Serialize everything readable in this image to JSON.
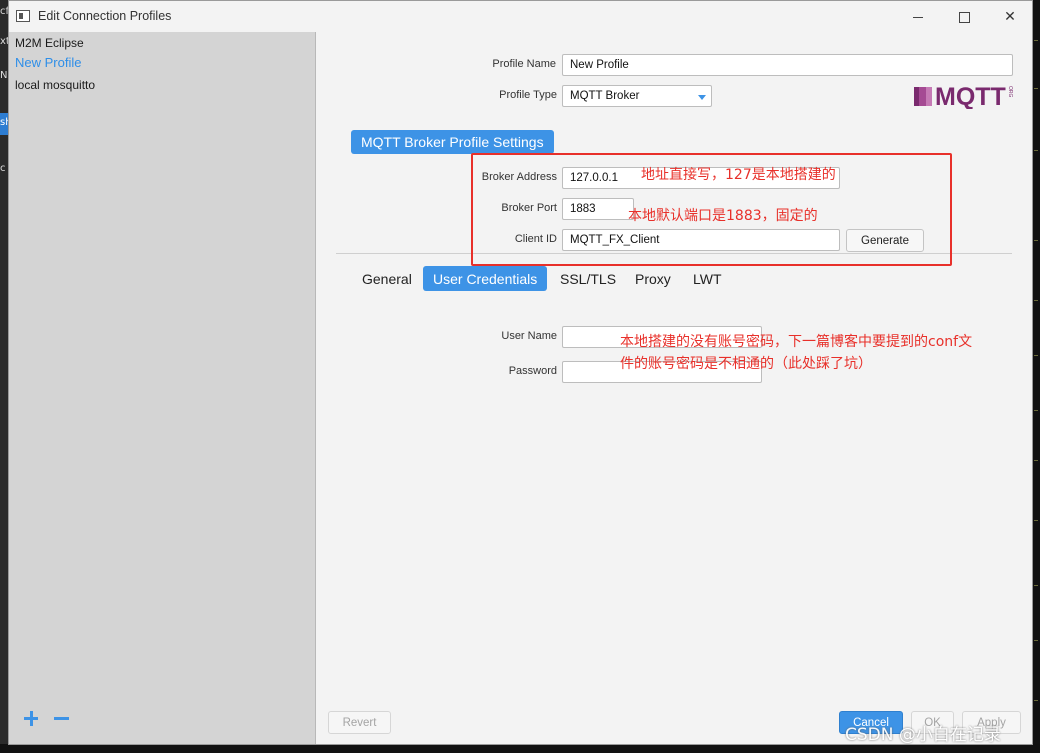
{
  "window": {
    "title": "Edit Connection Profiles",
    "close_glyph": "✕"
  },
  "sidebar": {
    "profiles": [
      {
        "label": "M2M Eclipse"
      },
      {
        "label": "New Profile"
      },
      {
        "label": "local mosquitto"
      }
    ],
    "selected_profile": "New Profile"
  },
  "profile": {
    "name_label": "Profile Name",
    "name_value": "New Profile",
    "type_label": "Profile Type",
    "type_value": "MQTT Broker"
  },
  "logo": {
    "text": "MQTT",
    "subtext": "ORG"
  },
  "broker": {
    "section_title": "MQTT Broker Profile Settings",
    "address_label": "Broker Address",
    "address_value": "127.0.0.1",
    "port_label": "Broker Port",
    "port_value": "1883",
    "client_id_label": "Client ID",
    "client_id_value": "MQTT_FX_Client",
    "generate_label": "Generate"
  },
  "tabs": [
    {
      "label": "General"
    },
    {
      "label": "User Credentials"
    },
    {
      "label": "SSL/TLS"
    },
    {
      "label": "Proxy"
    },
    {
      "label": "LWT"
    }
  ],
  "credentials": {
    "username_label": "User Name",
    "username_value": "",
    "password_label": "Password",
    "password_value": ""
  },
  "footer": {
    "revert_label": "Revert",
    "cancel_label": "Cancel",
    "ok_label": "OK",
    "apply_label": "Apply"
  },
  "annotations": {
    "address_note": "地址直接写，127是本地搭建的",
    "port_note": "本地默认端口是1883，固定的",
    "credentials_note_line1": "本地搭建的没有账号密码，下一篇博客中要提到的conf文",
    "credentials_note_line2": "件的账号密码是不相通的（此处踩了坑）"
  },
  "watermark": "CSDN @小白在记录",
  "background_fragments": [
    "cfi",
    "xt",
    "Ne",
    "sh",
    "c"
  ],
  "colors": {
    "accent": "#3d93e6",
    "annotation_red": "#e8302a",
    "logo_purple": "#7a2a6e"
  }
}
